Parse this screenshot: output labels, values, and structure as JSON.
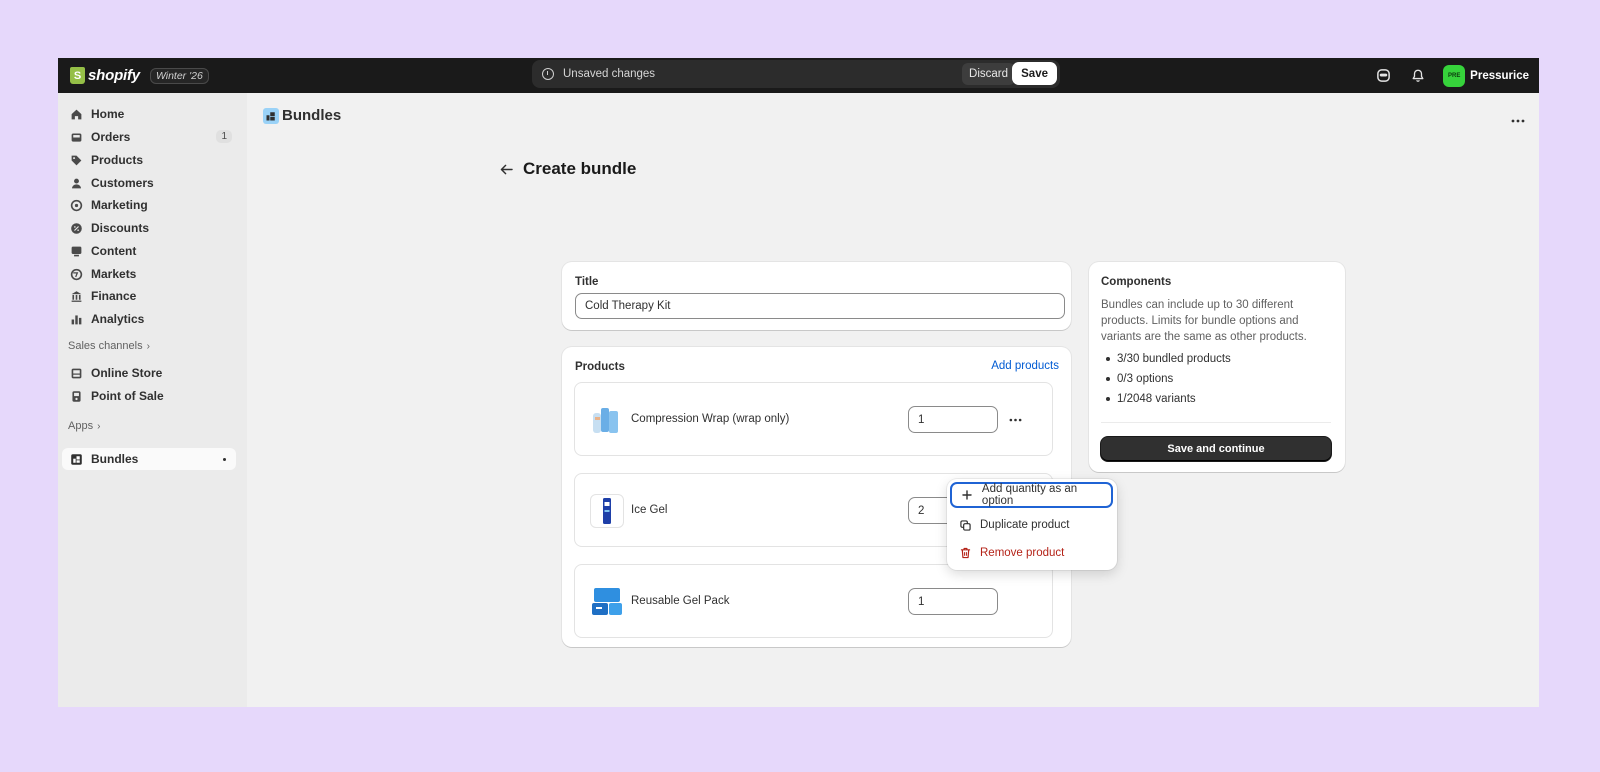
{
  "topbar": {
    "brand": "shopify",
    "edition": "Winter '26",
    "unsaved_text": "Unsaved changes",
    "discard_label": "Discard",
    "save_label": "Save",
    "store_badge": "PRE",
    "store_name": "Pressurice"
  },
  "sidebar": {
    "items": [
      {
        "label": "Home",
        "icon": "home-icon"
      },
      {
        "label": "Orders",
        "icon": "orders-icon",
        "count": "1"
      },
      {
        "label": "Products",
        "icon": "tag-icon"
      },
      {
        "label": "Customers",
        "icon": "person-icon"
      },
      {
        "label": "Marketing",
        "icon": "target-icon"
      },
      {
        "label": "Discounts",
        "icon": "discount-icon"
      },
      {
        "label": "Content",
        "icon": "content-icon"
      },
      {
        "label": "Markets",
        "icon": "globe-icon"
      },
      {
        "label": "Finance",
        "icon": "bank-icon"
      },
      {
        "label": "Analytics",
        "icon": "bar-chart-icon"
      }
    ],
    "sales_channels_label": "Sales channels",
    "channels": [
      {
        "label": "Online Store",
        "icon": "store-icon"
      },
      {
        "label": "Point of Sale",
        "icon": "pos-icon"
      }
    ],
    "apps_label": "Apps",
    "apps": [
      {
        "label": "Bundles",
        "icon": "bundles-icon"
      }
    ]
  },
  "app_header": {
    "title": "Bundles"
  },
  "page": {
    "title": "Create bundle"
  },
  "title_card": {
    "label": "Title",
    "value": "Cold Therapy Kit"
  },
  "products_card": {
    "label": "Products",
    "add_label": "Add products",
    "products": [
      {
        "name": "Compression Wrap (wrap only)",
        "qty": "1"
      },
      {
        "name": "Ice Gel",
        "qty": "2"
      },
      {
        "name": "Reusable Gel Pack",
        "qty": "1"
      }
    ]
  },
  "menu": {
    "items": [
      {
        "label": "Add quantity as an option",
        "icon": "plus-icon"
      },
      {
        "label": "Duplicate product",
        "icon": "duplicate-icon"
      },
      {
        "label": "Remove product",
        "icon": "trash-icon"
      }
    ]
  },
  "components": {
    "title": "Components",
    "description": "Bundles can include up to 30 different products. Limits for bundle options and variants are the same as other products.",
    "limits": [
      "3/30 bundled products",
      "0/3 options",
      "1/2048 variants"
    ],
    "button": "Save and continue"
  },
  "colors": {
    "accent": "#005bd3",
    "danger": "#b42318",
    "badge": "#36d33b",
    "background": "#e6d8fb"
  }
}
